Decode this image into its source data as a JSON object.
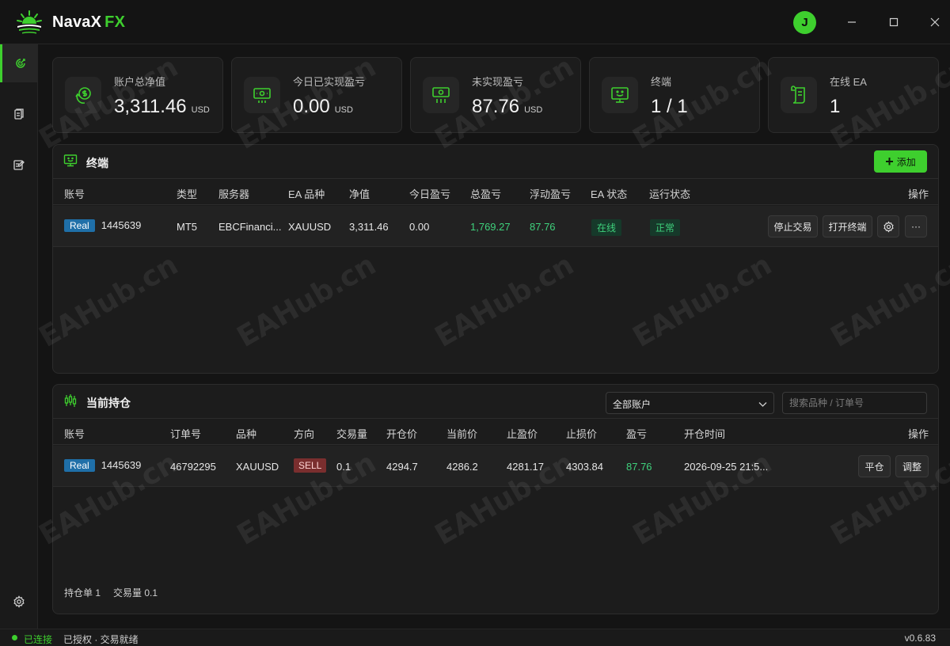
{
  "app": {
    "name": "NavaX",
    "name_accent": "FX",
    "avatar_letter": "J"
  },
  "colors": {
    "accent": "#3ecf2e",
    "profit": "#3fd17c",
    "real_tag": "#1f6fa8",
    "sell_tag": "#7a2e2e"
  },
  "sidebar": {
    "items": [
      {
        "icon": "dashboard-icon",
        "active": true
      },
      {
        "icon": "documents-icon",
        "active": false
      },
      {
        "icon": "edit-note-icon",
        "active": false
      },
      {
        "icon": "settings-icon",
        "active": false
      }
    ]
  },
  "cards": [
    {
      "icon": "money-cycle-icon",
      "label": "账户总净值",
      "value": "3,311.46",
      "unit": "USD"
    },
    {
      "icon": "cash-icon",
      "label": "今日已实现盈亏",
      "value": "0.00",
      "unit": "USD"
    },
    {
      "icon": "cash-flow-icon",
      "label": "未实现盈亏",
      "value": "87.76",
      "unit": "USD"
    },
    {
      "icon": "monitor-icon",
      "label": "终端",
      "value": "1 / 1",
      "unit": ""
    },
    {
      "icon": "scroll-icon",
      "label": "在线 EA",
      "value": "1",
      "unit": ""
    }
  ],
  "terminals": {
    "title": "终端",
    "add_label": "添加",
    "columns": [
      "账号",
      "类型",
      "服务器",
      "EA 品种",
      "净值",
      "今日盈亏",
      "总盈亏",
      "浮动盈亏",
      "EA 状态",
      "运行状态",
      "操作"
    ],
    "rows": [
      {
        "account_type": "Real",
        "account": "1445639",
        "type": "MT5",
        "server": "EBCFinanci...",
        "symbol": "XAUUSD",
        "equity": "3,311.46",
        "today_pnl": "0.00",
        "total_pnl": "1,769.27",
        "floating_pnl": "87.76",
        "ea_status": "在线",
        "run_status": "正常",
        "stop_label": "停止交易",
        "open_label": "打开终端",
        "more_label": "···"
      }
    ]
  },
  "positions": {
    "title": "当前持仓",
    "account_filter": "全部账户",
    "search_placeholder": "搜索品种 / 订单号",
    "columns": [
      "账号",
      "订单号",
      "品种",
      "方向",
      "交易量",
      "开仓价",
      "当前价",
      "止盈价",
      "止损价",
      "盈亏",
      "开仓时间",
      "操作"
    ],
    "rows": [
      {
        "account_type": "Real",
        "account": "1445639",
        "order": "46792295",
        "symbol": "XAUUSD",
        "side": "SELL",
        "volume": "0.1",
        "open_price": "4294.7",
        "current_price": "4286.2",
        "tp": "4281.17",
        "sl": "4303.84",
        "pnl": "87.76",
        "open_time": "2026-09-25 21:5...",
        "close_label": "平仓",
        "adjust_label": "调整"
      }
    ],
    "summary_count": "持仓单 1",
    "summary_volume": "交易量 0.1"
  },
  "statusbar": {
    "connection": "已连接",
    "auth": "已授权 · 交易就绪",
    "version": "v0.6.83"
  },
  "watermark": "EAHub.cn"
}
